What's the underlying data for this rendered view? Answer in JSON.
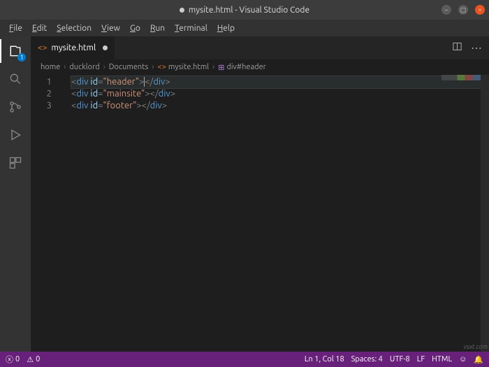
{
  "title": "mysite.html - Visual Studio Code",
  "menu": [
    "File",
    "Edit",
    "Selection",
    "View",
    "Go",
    "Run",
    "Terminal",
    "Help"
  ],
  "activity": {
    "explorer_badge": "1"
  },
  "tab": {
    "icon": "<>",
    "label": "mysite.html"
  },
  "breadcrumbs": [
    "home",
    "ducklord",
    "Documents",
    "mysite.html",
    "div#header"
  ],
  "code": {
    "line_numbers": [
      "1",
      "2",
      "3"
    ],
    "lines": [
      {
        "tag": "div",
        "attr": "id",
        "val": "header",
        "cursor": true
      },
      {
        "tag": "div",
        "attr": "id",
        "val": "mainsite",
        "cursor": false
      },
      {
        "tag": "div",
        "attr": "id",
        "val": "footer",
        "cursor": false
      }
    ]
  },
  "status": {
    "errors": "0",
    "warnings": "0",
    "ln_col": "Ln 1, Col 18",
    "spaces": "Spaces: 4",
    "encoding": "UTF-8",
    "eol": "LF",
    "lang": "HTML",
    "feedback": "☺"
  },
  "watermark": "vsxt.com"
}
